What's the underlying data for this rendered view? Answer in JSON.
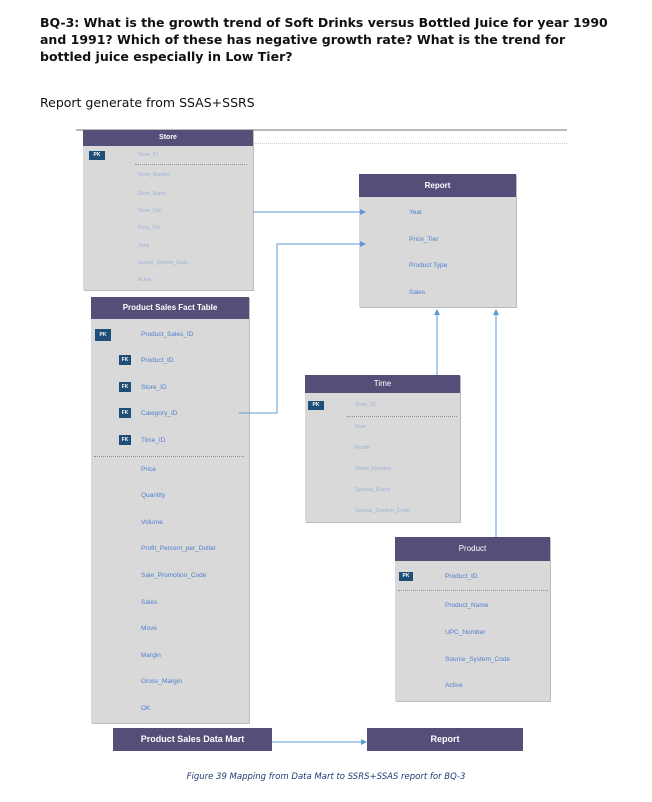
{
  "question": "BQ-3: What is the growth trend of Soft Drinks versus Bottled Juice for year 1990 and 1991? Which of these has negative growth rate? What is the trend for bottled juice especially in Low Tier?",
  "subtitle": "Report generate from SSAS+SSRS",
  "caption": "Figure 39 Mapping from Data Mart to SSRS+SSAS report for BQ-3",
  "store": {
    "title": "Store",
    "pk_label": "PK",
    "fields": [
      "Store_ID",
      "Store_Number",
      "Store_Name",
      "Store_City",
      "Price_Tier",
      "Zone",
      "Source_System_Code",
      "Active"
    ]
  },
  "report_top": {
    "title": "Report",
    "fields": [
      "Year",
      "Price_Tier",
      "Product Type",
      "Sales"
    ]
  },
  "fact": {
    "title": "Product Sales Fact Table",
    "pk_label": "PK",
    "fk_label": "FK",
    "key_fields": [
      "Product_Sales_ID",
      "Product_ID",
      "Store_ID",
      "Category_ID",
      "Time_ID"
    ],
    "measures": [
      "Price",
      "Quantity",
      "Volume",
      "Profit_Percent_per_Dollar",
      "Sale_Promotion_Code",
      "Sales",
      "Move",
      "Margin",
      "Gross_Margin",
      "OK"
    ]
  },
  "time": {
    "title": "Time",
    "pk_label": "PK",
    "fields": [
      "Time_ID",
      "Year",
      "Month",
      "Week_Number",
      "Special_Event",
      "Source_System_Code"
    ]
  },
  "product": {
    "title": "Product",
    "pk_label": "PK",
    "fields": [
      "Product_ID",
      "Product_Name",
      "UPC_Number",
      "Source_System_Code",
      "Active"
    ]
  },
  "bottom": {
    "left": "Product Sales Data Mart",
    "right": "Report"
  }
}
